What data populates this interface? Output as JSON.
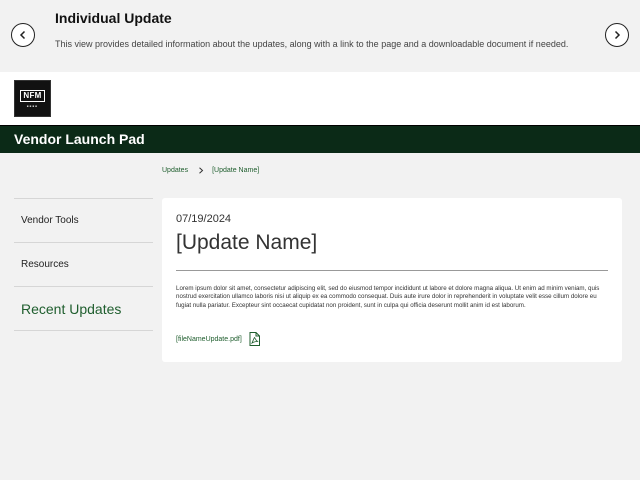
{
  "info": {
    "title": "Individual Update",
    "description": "This view provides detailed information about the updates, along with a link to the page and a downloadable document if needed.",
    "prev_icon": "chevron-left-icon",
    "next_icon": "chevron-right-icon"
  },
  "logo": {
    "text": "NFM"
  },
  "header": {
    "title": "Vendor Launch Pad",
    "color": "#0b2a17"
  },
  "breadcrumb": {
    "items": [
      "Updates",
      "[Update Name]"
    ]
  },
  "sidebar": {
    "items": [
      {
        "label": "Vendor Tools"
      },
      {
        "label": "Resources"
      },
      {
        "label": "Recent Updates",
        "active": true
      }
    ]
  },
  "update": {
    "date": "07/19/2024",
    "title": "[Update Name]",
    "body": "Lorem ipsum dolor sit amet, consectetur adipiscing elit, sed do eiusmod tempor incididunt ut labore et dolore magna aliqua. Ut enim ad minim veniam, quis nostrud exercitation ullamco laboris nisi ut aliquip ex ea commodo consequat. Duis aute irure dolor in reprehenderit in voluptate velit esse cillum dolore eu fugiat nulla pariatur. Excepteur sint occaecat cupidatat non proident, sunt in culpa qui officia deserunt mollit anim id est laborum.",
    "file_name": "[fileNameUpdate.pdf]",
    "file_icon": "pdf-icon"
  },
  "colors": {
    "accent": "#1f5e2e",
    "background": "#f2f2f2"
  }
}
